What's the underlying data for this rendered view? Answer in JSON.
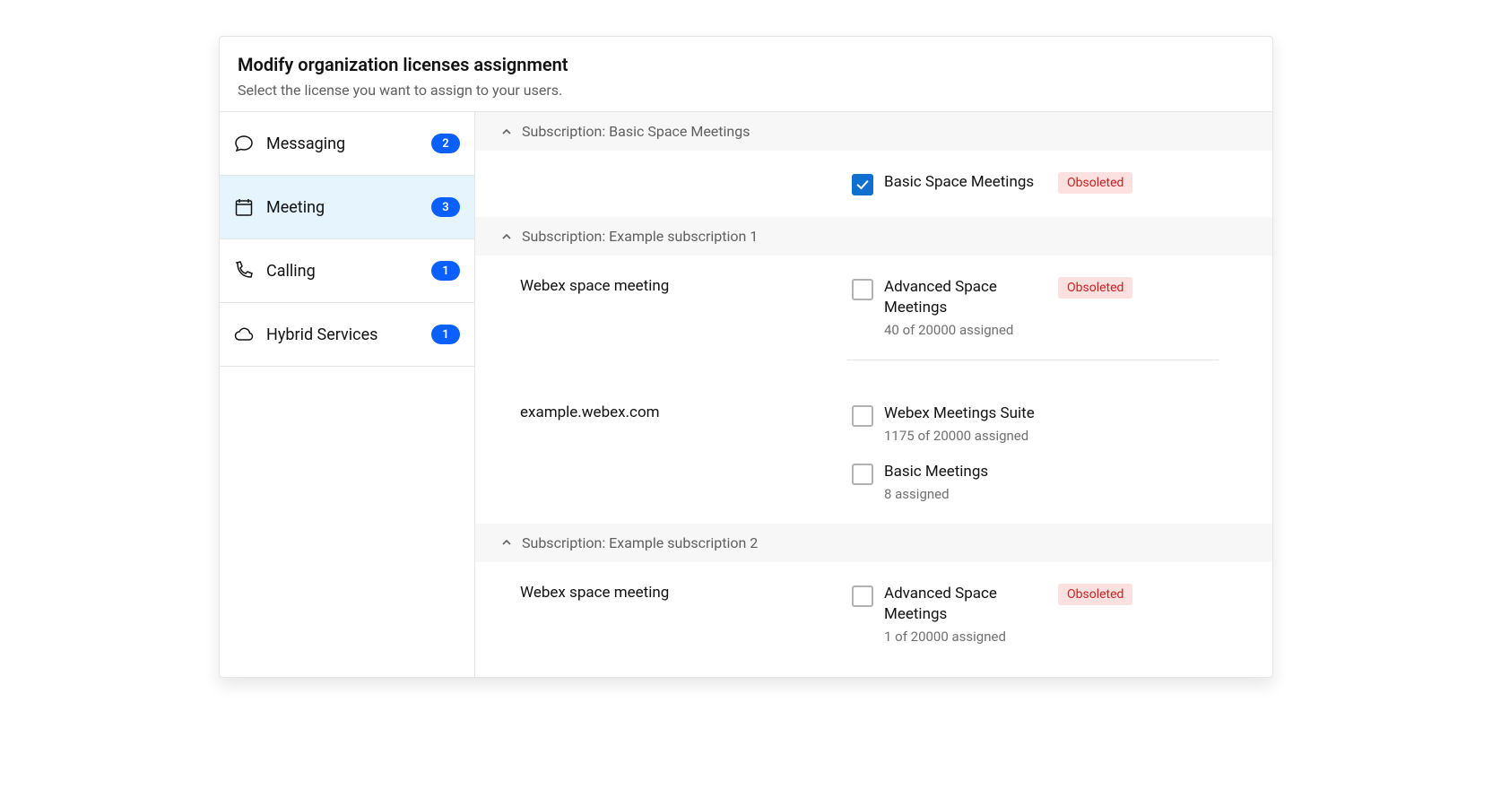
{
  "header": {
    "title": "Modify organization licenses assignment",
    "subtitle": "Select the license you want to assign to your users."
  },
  "sidebar": {
    "items": [
      {
        "label": "Messaging",
        "count": "2"
      },
      {
        "label": "Meeting",
        "count": "3"
      },
      {
        "label": "Calling",
        "count": "1"
      },
      {
        "label": "Hybrid Services",
        "count": "1"
      }
    ]
  },
  "subscriptions": {
    "s0": {
      "header": "Subscription: Basic Space Meetings",
      "item0_label": "Basic Space Meetings",
      "item0_status": "Obsoleted"
    },
    "s1": {
      "header": "Subscription: Example subscription 1",
      "row0_name": "Webex space meeting",
      "row0_opt_label": "Advanced Space Meetings",
      "row0_opt_sub": "40 of 20000 assigned",
      "row0_opt_status": "Obsoleted",
      "row1_name": "example.webex.com",
      "row1_opt0_label": "Webex Meetings Suite",
      "row1_opt0_sub": "1175 of 20000 assigned",
      "row1_opt1_label": "Basic Meetings",
      "row1_opt1_sub": "8 assigned"
    },
    "s2": {
      "header": "Subscription: Example subscription 2",
      "row0_name": "Webex space meeting",
      "row0_opt_label": "Advanced Space Meetings",
      "row0_opt_sub": "1 of 20000 assigned",
      "row0_opt_status": "Obsoleted"
    }
  }
}
